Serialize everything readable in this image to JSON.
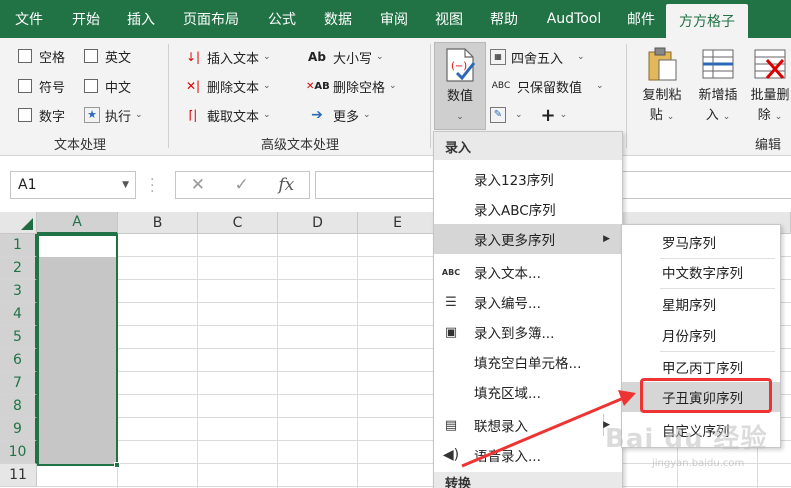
{
  "tabs": [
    "文件",
    "开始",
    "插入",
    "页面布局",
    "公式",
    "数据",
    "审阅",
    "视图",
    "帮助",
    "AudTool",
    "邮件",
    "方方格子"
  ],
  "active_tab_index": 11,
  "ribbon": {
    "text_group": {
      "label": "文本处理",
      "checkboxes": [
        "空格",
        "英文",
        "符号",
        "中文",
        "数字"
      ],
      "exec_label": "执行"
    },
    "adv_group": {
      "label": "高级文本处理",
      "insert_text": "插入文本",
      "delete_text": "删除文本",
      "cut_text": "截取文本",
      "case_icon": "Ab",
      "case_label": "大小写",
      "del_space_icon": "AB",
      "del_space": "删除空格",
      "more": "更多"
    },
    "value_group": {
      "big_label": "数值",
      "round": "四舍五入",
      "keep_value_icon": "ABC",
      "keep_value": "只保留数值",
      "plus": "+"
    },
    "edit_group": {
      "label": "编辑",
      "copy_paste_1": "复制粘",
      "copy_paste_2": "贴",
      "new_insert_1": "新增插",
      "new_insert_2": "入",
      "batch_delete_1": "批量删",
      "batch_delete_2": "除"
    }
  },
  "formula_bar": {
    "name_box": "A1",
    "cancel_icon": "✕",
    "enter_icon": "✓",
    "fx_label": "fx"
  },
  "grid": {
    "columns": [
      "A",
      "B",
      "C",
      "D",
      "E"
    ],
    "rows": [
      "1",
      "2",
      "3",
      "4",
      "5",
      "6",
      "7",
      "8",
      "9",
      "10",
      "11"
    ],
    "selected_column": "A"
  },
  "menu": {
    "section_input": "录入",
    "items": [
      {
        "label": "录入123序列"
      },
      {
        "label": "录入ABC序列"
      },
      {
        "label": "录入更多序列"
      },
      {
        "label": "录入文本..."
      },
      {
        "label": "录入编号..."
      },
      {
        "label": "录入到多簿..."
      },
      {
        "label": "填充空白单元格..."
      },
      {
        "label": "填充区域..."
      },
      {
        "label": "联想录入"
      },
      {
        "label": "语音录入..."
      }
    ],
    "text_icon_label": "ABC",
    "section_convert": "转换"
  },
  "submenu": {
    "items": [
      "罗马序列",
      "中文数字序列",
      "星期序列",
      "月份序列",
      "甲乙丙丁序列",
      "子丑寅卯序列",
      "自定义序列"
    ],
    "highlighted": "子丑寅卯序列"
  },
  "watermark": {
    "main": "Bai du 经验",
    "sub": "jingyan.baidu.com"
  },
  "colors": {
    "excel_green": "#217346",
    "highlight_red": "#e33333"
  }
}
